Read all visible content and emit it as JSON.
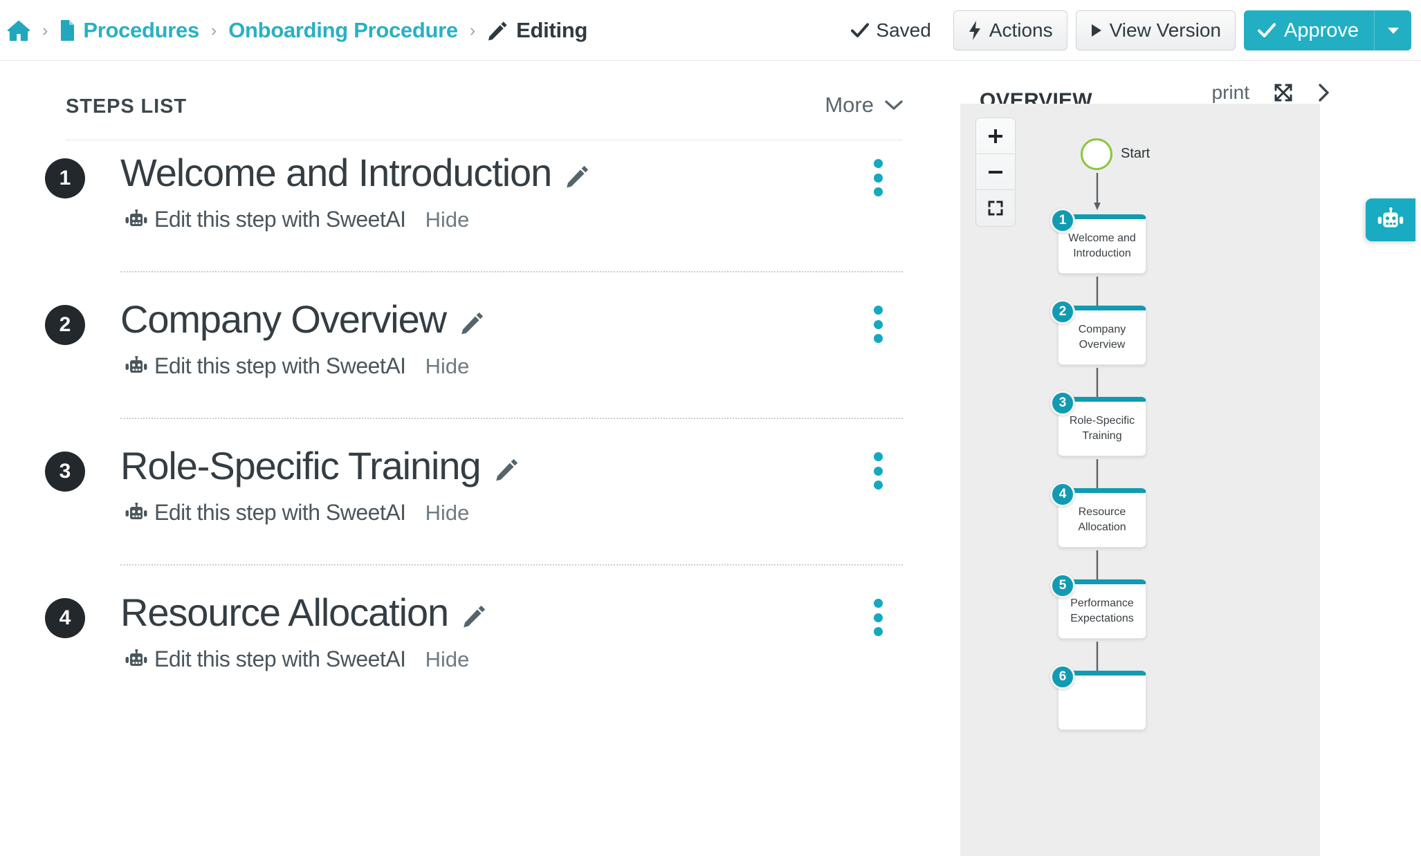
{
  "topbar": {
    "breadcrumb": [
      {
        "icon": "home-icon",
        "label": ""
      },
      {
        "icon": "document-icon",
        "label": "Procedures"
      },
      {
        "icon": "",
        "label": "Onboarding Procedure"
      },
      {
        "icon": "pencil-icon",
        "label": "Editing"
      }
    ],
    "separator": "›",
    "saved_label": "Saved",
    "actions_label": "Actions",
    "view_version_label": "View Version",
    "approve_label": "Approve",
    "accent_color": "#22afc4"
  },
  "steps_panel": {
    "title": "STEPS LIST",
    "more_label": "More",
    "steps": [
      {
        "number": "1",
        "title": "Welcome and Introduction",
        "ai_label": "Edit this step with SweetAI",
        "hide_label": "Hide"
      },
      {
        "number": "2",
        "title": "Company Overview",
        "ai_label": "Edit this step with SweetAI",
        "hide_label": "Hide"
      },
      {
        "number": "3",
        "title": "Role-Specific Training",
        "ai_label": "Edit this step with SweetAI",
        "hide_label": "Hide"
      },
      {
        "number": "4",
        "title": "Resource Allocation",
        "ai_label": "Edit this step with SweetAI",
        "hide_label": "Hide"
      }
    ]
  },
  "overview": {
    "title": "OVERVIEW",
    "print_label": "print",
    "zoom_in_label": "+",
    "zoom_out_label": "−",
    "node_border_color": "#119bb3",
    "start_node": {
      "label": "Start",
      "color": "#8cc63f"
    },
    "nodes": [
      {
        "number": "1",
        "label": "Welcome and Introduction"
      },
      {
        "number": "2",
        "label": "Company Overview"
      },
      {
        "number": "3",
        "label": "Role-Specific Training"
      },
      {
        "number": "4",
        "label": "Resource Allocation"
      },
      {
        "number": "5",
        "label": "Performance Expectations"
      },
      {
        "number": "6",
        "label": ""
      }
    ]
  },
  "ai_assistant": {
    "tooltip": "SweetAI"
  }
}
